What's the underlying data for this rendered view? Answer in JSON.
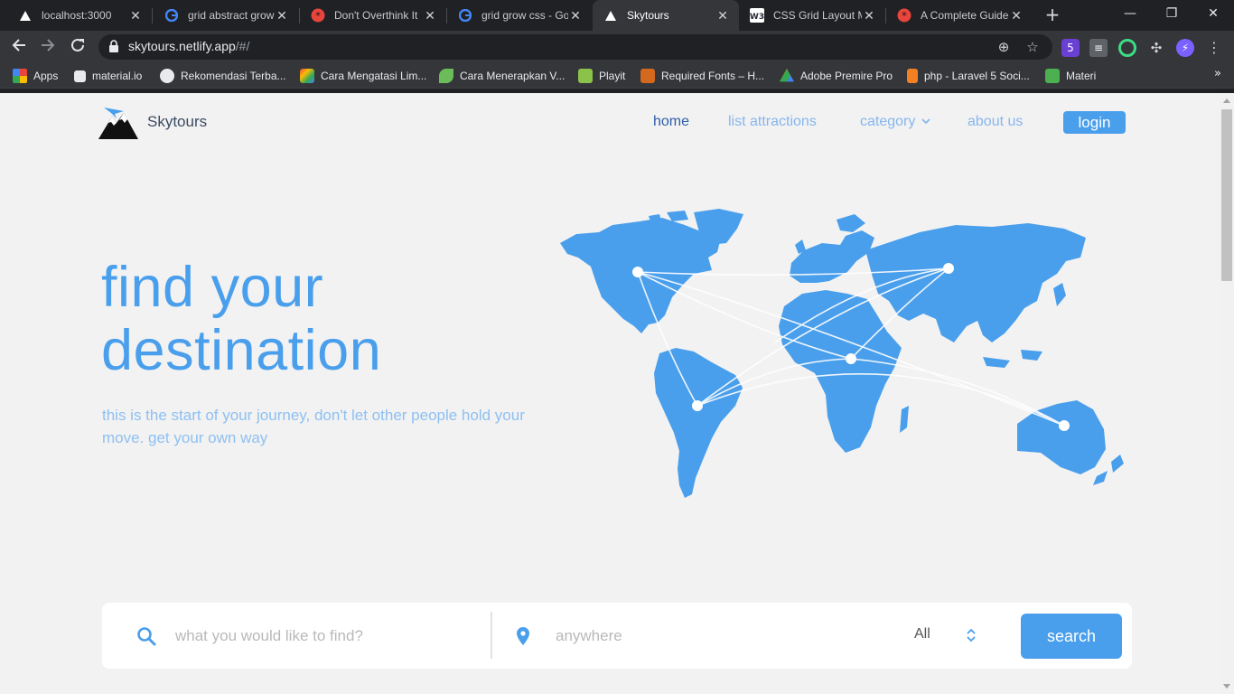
{
  "browser": {
    "tabs": [
      {
        "title": "localhost:3000",
        "icon": "vercel-triangle-icon"
      },
      {
        "title": "grid abstract grow",
        "icon": "google-icon"
      },
      {
        "title": "Don't Overthink It",
        "icon": "css-tricks-icon"
      },
      {
        "title": "grid grow css - Go",
        "icon": "google-icon"
      },
      {
        "title": "Skytours",
        "icon": "vercel-triangle-icon"
      },
      {
        "title": "CSS Grid Layout M",
        "icon": "w3schools-icon"
      },
      {
        "title": "A Complete Guide",
        "icon": "css-tricks-icon"
      }
    ],
    "url_host": "skytours.netlify.app",
    "url_path": "/#/",
    "bookmarks": [
      {
        "label": "Apps",
        "color": "#e8453c"
      },
      {
        "label": "material.io",
        "color": "#ffffff"
      },
      {
        "label": "Rekomendasi Terba...",
        "color": "#e8eaed"
      },
      {
        "label": "Cara Mengatasi Lim...",
        "color": "#e8a33c"
      },
      {
        "label": "Cara Menerapkan V...",
        "color": "#6bbd5a"
      },
      {
        "label": "Playit",
        "color": "#8bc34a"
      },
      {
        "label": "Required Fonts – H...",
        "color": "#d2691e"
      },
      {
        "label": "Adobe Premire Pro",
        "color": "#fbbc04"
      },
      {
        "label": "php - Laravel 5 Soci...",
        "color": "#f48024"
      },
      {
        "label": "Materi",
        "color": "#4caf50"
      }
    ],
    "bookmarks_more": "»",
    "extension_badge": "5"
  },
  "site": {
    "brand": "Skytours",
    "nav": {
      "home": "home",
      "list_attractions": "list attractions",
      "category": "category",
      "about_us": "about us",
      "login": "login"
    },
    "hero": {
      "title_line1": "find your",
      "title_line2": "destination",
      "subtitle": "this is the start of your journey, don't let other people hold your move. get your own way"
    },
    "search": {
      "query_placeholder": "what you would like to find?",
      "location_placeholder": "anywhere",
      "category_value": "All",
      "button": "search"
    },
    "colors": {
      "accent": "#4a9fec",
      "nav_active": "#2f5fa8",
      "nav_link": "#86b6ee",
      "background": "#f2f2f2"
    }
  }
}
